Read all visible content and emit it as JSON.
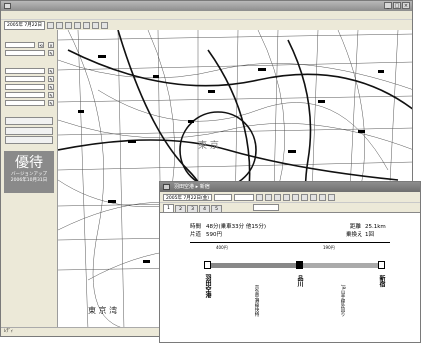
{
  "main_window": {
    "title": "",
    "menu": [
      "",
      "",
      "",
      "",
      ""
    ],
    "date": "2005年 7月22日",
    "status_text": "ﾚﾃﾞｨ"
  },
  "side_panel": {
    "promo_big": "優待",
    "promo_line1": "バージョンアップ",
    "promo_line2": "2006年10月31日"
  },
  "map": {
    "labels": {
      "tokyo_center": "東 京",
      "tokyo_bay": "東 京 湾"
    }
  },
  "route_window": {
    "title": "羽田空港 ▸ 新宿",
    "date": "2005年 7月22日(金)",
    "tabs": [
      "1",
      "2",
      "3",
      "4",
      "5"
    ],
    "summary": {
      "time_label": "時間",
      "time_value": "48分(乗車33分 他15分)",
      "fare_label": "片道",
      "fare_value": "590円",
      "distance_label": "距離",
      "distance_value": "25.1km",
      "transfers_label": "乗換え",
      "transfers_value": "1回"
    },
    "legs": [
      {
        "fare": "400円",
        "minutes": "",
        "km": ""
      },
      {
        "fare": "190円",
        "minutes": "",
        "km": ""
      }
    ],
    "stations": [
      "羽田空港",
      "品川",
      "新宿"
    ],
    "lines": [
      "京急空港線快特",
      "JR山手線外回り"
    ]
  }
}
